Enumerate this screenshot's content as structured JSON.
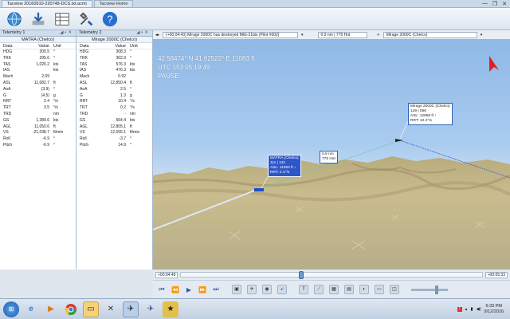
{
  "window": {
    "tabs": [
      "Tacview 20160910-220748-DCS.txt.acmi",
      "Tacview Home"
    ],
    "controls": [
      "—",
      "❐",
      "✕"
    ]
  },
  "toolbar": {
    "icons": [
      "globe-icon",
      "download-icon",
      "table-icon",
      "settings-tools-icon",
      "help-icon"
    ]
  },
  "telemetry1": {
    "title": "Telemetry 1",
    "object": "MATRA (Chelco)",
    "columns": [
      "Data",
      "Value",
      "Unit"
    ],
    "rows": [
      [
        "HDG",
        "300.5",
        "°"
      ],
      [
        "TRK",
        "295.6",
        "°"
      ],
      [
        "TAS",
        "1,026.2",
        "kts"
      ],
      [
        "IAS",
        "",
        "kts"
      ],
      [
        "Mach",
        "2.09",
        ""
      ],
      [
        "ASL",
        "11,082.7",
        "ft"
      ],
      [
        "AoA",
        "(3.9)",
        "°"
      ],
      [
        "G",
        "(4.5)",
        "g"
      ],
      [
        "RRT",
        "2.4",
        "°/s"
      ],
      [
        "TRT",
        "3.5",
        "°/s"
      ],
      [
        "TRD",
        "",
        "nm"
      ],
      [
        "GS",
        "1,389.6",
        "kts"
      ],
      [
        "AGL",
        "11,050.6",
        "ft"
      ],
      [
        "VS",
        "-21,038.7",
        "ft/min"
      ],
      [
        "Roll",
        "-6.9",
        "°"
      ],
      [
        "Pitch",
        "-6.9",
        "°"
      ]
    ]
  },
  "telemetry2": {
    "title": "Telemetry 2",
    "object": "Mirage 2000C (Chelco)",
    "columns": [
      "Data",
      "Value",
      "Unit"
    ],
    "rows": [
      [
        "HDG",
        "308.3",
        "°"
      ],
      [
        "TRK",
        "302.9",
        "°"
      ],
      [
        "TAS",
        "576.3",
        "kts"
      ],
      [
        "IAS",
        "476.3",
        "kts"
      ],
      [
        "Mach",
        "0.92",
        ""
      ],
      [
        "ASL",
        "12,850.4",
        "ft"
      ],
      [
        "AoA",
        "2.5",
        "°"
      ],
      [
        "G",
        "1.3",
        "g"
      ],
      [
        "RRT",
        "10.4",
        "°/s"
      ],
      [
        "TRT",
        "0.2",
        "°/s"
      ],
      [
        "TRD",
        "-",
        "nm"
      ],
      [
        "GS",
        "564.4",
        "kts"
      ],
      [
        "AGL",
        "12,805.1",
        "ft"
      ],
      [
        "VS",
        "12,555.1",
        "ft/min"
      ],
      [
        "Roll",
        "-3.7",
        "°"
      ],
      [
        "Pitch",
        "14.9",
        "°"
      ]
    ]
  },
  "viewbar": {
    "event": "(+00:04:43) Mirage 2000C has destroyed MiG-21bis (Pilot #002)",
    "distance": "0.9 nm | 775 Hot",
    "tracked": "Mirage 2000C (Chelco)"
  },
  "overlay": {
    "coords": "42.58474° N  41.62522° E  11083 ft",
    "utc": "UTC 153.05:19:49",
    "status": "PAUSE"
  },
  "labels": {
    "mirage": [
      "Mirage 2000C (Chelco)",
      "129 | 056",
      "ASL: 12858 ft ↑",
      "RRT: 10.4°/s"
    ],
    "matra": [
      "MATRA (Chelco)",
      "111 | 131",
      "ASL: 11083 ft ↓",
      "RRT: 2.4°/s"
    ],
    "range": [
      "0.9 nm",
      "775 Hot"
    ]
  },
  "timeline": {
    "start": "+00:04:49",
    "end": "+00:05:33",
    "position": 0.4
  },
  "volume": 0.7,
  "taskbar": {
    "time": "6:33 PM",
    "date": "9/12/2016"
  },
  "colors": {
    "accent": "#2f56c8",
    "sky": "#a9cbef",
    "compass_arrow": "#e02020"
  }
}
